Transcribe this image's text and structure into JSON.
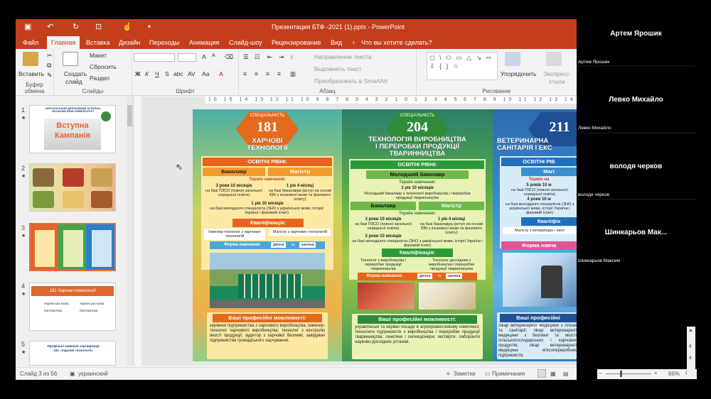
{
  "window": {
    "title": "Презентация БТФ -2021 (1).pptx - PowerPoint",
    "tell_me": "Что вы хотите сделать?"
  },
  "menu": [
    "Файл",
    "Главная",
    "Вставка",
    "Дизайн",
    "Переходы",
    "Анимация",
    "Слайд-шоу",
    "Рецензирование",
    "Вид"
  ],
  "ribbon": {
    "clipboard": {
      "paste": "Вставить",
      "label": "Буфер обмена"
    },
    "slides": {
      "create": "Создать",
      "slide": "слайд",
      "layout": "Макет",
      "reset": "Сбросить",
      "section": "Раздел",
      "label": "Слайды"
    },
    "font": {
      "label": "Шрифт",
      "bold": "Ж",
      "italic": "К",
      "underline": "Ч",
      "strike": "S",
      "shadow": "abc",
      "spacing": "AV",
      "case": "Aa",
      "increase": "A",
      "decrease": "A",
      "color": "A"
    },
    "paragraph": {
      "label": "Абзац",
      "text_direction": "Направление текста",
      "align_text": "Выровнять текст",
      "smartart": "Преобразовать в SmartArt"
    },
    "drawing": {
      "label": "Рисование",
      "arrange": "Упорядочить",
      "quick_styles": "Экспресс-",
      "quick_styles2": "стили",
      "shapes": "◻ \\ ⬭ ▭ △ ↘ ⇨ ⇩ { } ☆"
    }
  },
  "thumbnails": [
    {
      "num": "1",
      "star": "★",
      "title_line1": "Вступна",
      "title_line2": "Кампанія",
      "header": "ХЕРСОНСЬКИЙ ДЕРЖАВНИЙ АГРАРНО-ЕКОНОМІЧНИЙ УНІВЕРСИТЕТ"
    },
    {
      "num": "2",
      "star": "★"
    },
    {
      "num": "3",
      "star": "★"
    },
    {
      "num": "4",
      "star": "★",
      "title": "181 Харчові технології",
      "row1a": "Українська мова",
      "row1b": "Українська мова",
      "row2a": "Математика",
      "row2b": "Математика"
    },
    {
      "num": "5",
      "star": "★",
      "line1": "Профільні зовнішні сертифікації",
      "line2": "181 «Харчові технології»"
    }
  ],
  "slide": {
    "p1": {
      "spec_label": "СПЕЦІАЛЬНІСТЬ",
      "num": "181",
      "title1": "ХАРЧОВІ",
      "title2": "ТЕХНОЛОГІЇ",
      "levels": "ОСВІТНІ РІВНІ:",
      "bachelor": "Бакалавр",
      "master": "Магістр",
      "term": "Термін навчання:",
      "b_term": "3 роки 10 місяців",
      "b_term_note": "на базі ПЗСО (повної загальної середньої освіти)",
      "m_term": "1 рік 4 місяці",
      "m_term_note": "на базі бакалавра (вступ на основі ЄВІ з іноземної мови та фахового іспиту)",
      "b_term2": "1 рік 10 місяців",
      "b_term2_note": "на базі молодшого спеціаліста (ЗНО з української мови, історії України і фаховий іспит)",
      "qual": "Кваліфікація:",
      "q1": "Інженер-технолог з харчових технологій",
      "q2": "Магістр з харчових технологій",
      "form": "Форма навчання:",
      "day": "денна",
      "and": "та",
      "ext": "заочна",
      "opp": "Ваші професійні можливості:",
      "opp_text": "керівник підприємства з харчового виробництва; інженер-технолог харчового виробництва; технолог з контролю якості продукції; аудитор з харчової безпеки; завідувач підприємства громадського харчування."
    },
    "p2": {
      "spec_label": "СПЕЦІАЛЬНІСТЬ",
      "num": "204",
      "title1": "ТЕХНОЛОГІЯ ВИРОБНИЦТВА",
      "title2": "І ПЕРЕРОБКИ ПРОДУКЦІЇ",
      "title3": "ТВАРИННИЦТВА",
      "levels": "ОСВІТНІ РІВНІ:",
      "junior": "Молодший бакалавр",
      "term": "Термін навчання:",
      "j_term": "1 рік 10 місяців",
      "j_qual": "Молодший бакалавр з технології виробництва і переробки продукції тваринництва",
      "bachelor": "Бакалавр",
      "master": "Магістр",
      "term2": "Термін навчання:",
      "b_term": "3 роки 10 місяців",
      "b_term_note": "на базі ПЗСО (повної загальної середньої освіти)",
      "m_term": "1 рік 4 місяці",
      "m_term_note": "на базі бакалавра (вступ на основі ЄВІ з іноземної мови та фахового іспиту)",
      "b_term2": "2 роки 10 місяців",
      "b_term2_note": "на базі молодшого спеціаліста (ЗНО з української мови, історії України і фаховий іспит)",
      "qual": "Кваліфікація:",
      "q1": "Технолог з виробництва і переробки продукції тваринництва",
      "q2": "Технолог-дослідник з виробництва і переробки продукції тваринництва",
      "form": "Форма навчання:",
      "day": "денна",
      "and": "та",
      "ext": "заочна",
      "opp": "Ваші професійні можливості:",
      "opp_text": "управлінські та керівні посади в агропромисловому комплексі; технологи підприємств з виробництва і переробки продукції тваринництва; генетики і селекціонери; експерти; лаборанти науково-дослідних установ."
    },
    "p3": {
      "num": "211",
      "title1": "ВЕТЕРИНАРНА",
      "title2": "САНІТАРІЯ І ЕКС",
      "levels": "ОСВІТНІ РІВ",
      "master": "Магі",
      "term": "Термін на",
      "t1": "5 років 10 м",
      "t1_note": "на базі ПЗСО (повної загальної середньої освіти)",
      "t2": "4 роки 10 м",
      "t2_note": "на базі молодшого спеціаліста (ЗНО з української мови, історії України і фаховий іспит)",
      "qual": "Кваліфік",
      "q1": "Магістр з ветеринарн і експ",
      "form": "Форма навча",
      "opp": "Ваші професійні можливості:",
      "opp_text": "лікар ветеринарної медицини з гігієни та санітарії; лікар ветеринарної медицини з безпеки та якості сільськогосподарських і харчових продуктів; лікар ветеринарної медицини м'ясопереробних підприємств."
    }
  },
  "status": {
    "slide": "Слайд 3 из 56",
    "lang": "украинский",
    "notes": "Заметки",
    "comments": "Примечания",
    "zoom": "66%"
  },
  "participants": [
    {
      "name": "Артем Ярошик",
      "small": "Артем Ярошик"
    },
    {
      "name": "Левко Михайло",
      "small": "Левко Михайло"
    },
    {
      "name": "володя черков",
      "small": "володя черков"
    },
    {
      "name": "Шинкарьов  Мак...",
      "small": "Шинкарьов Максим"
    }
  ]
}
